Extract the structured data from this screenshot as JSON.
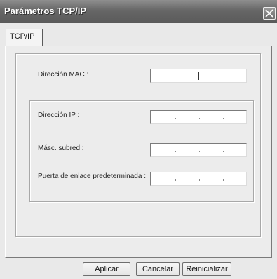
{
  "window": {
    "title": "Parámetros TCP/IP"
  },
  "tabs": [
    {
      "label": "TCP/IP"
    }
  ],
  "form": {
    "mac_label": "Dirección MAC :",
    "ip_label": "Dirección IP :",
    "subnet_label": "Másc. subred :",
    "gateway_label": "Puerta de enlace predeterminada :"
  },
  "buttons": {
    "apply": "Aplicar",
    "cancel": "Cancelar",
    "reset": "Reinicializar"
  },
  "icons": {
    "close": "close-icon"
  },
  "colors": {
    "titlebar": "#666666",
    "background": "#e9e9e9",
    "field": "#ffffff"
  }
}
